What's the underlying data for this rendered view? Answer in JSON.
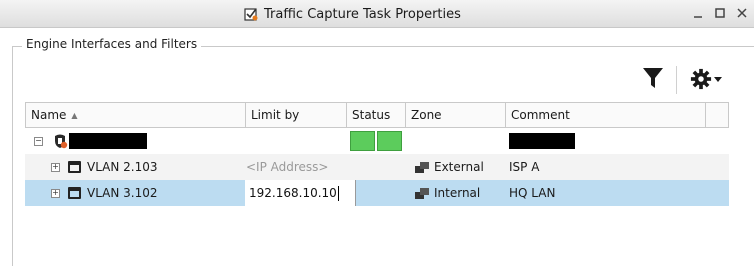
{
  "window": {
    "title": "Traffic Capture Task Properties"
  },
  "section": {
    "legend": "Engine Interfaces and Filters"
  },
  "toolbar": {
    "filter_icon": "filter-icon",
    "settings_icon": "gear-icon"
  },
  "table": {
    "columns": {
      "name": "Name",
      "limit_by": "Limit by",
      "status": "Status",
      "zone": "Zone",
      "comment": "Comment"
    },
    "sort_column": "Name",
    "sort_direction": "ascending",
    "rows": [
      {
        "name": "",
        "name_redacted": true,
        "limit_by": "",
        "status_colors": [
          "#5ccc5c",
          "#5ccc5c"
        ],
        "zone": "",
        "comment": "",
        "comment_redacted": true,
        "expanded": true
      },
      {
        "name": "VLAN 2.103",
        "limit_by_placeholder": "<IP Address>",
        "zone": "External",
        "comment": "ISP A",
        "expanded": false
      },
      {
        "name": "VLAN 3.102",
        "limit_by": "192.168.10.10",
        "zone": "Internal",
        "comment": "HQ LAN",
        "expanded": false,
        "selected": true
      }
    ]
  },
  "colors": {
    "selection": "#bcdcf1",
    "status_ok": "#5ccc5c"
  }
}
